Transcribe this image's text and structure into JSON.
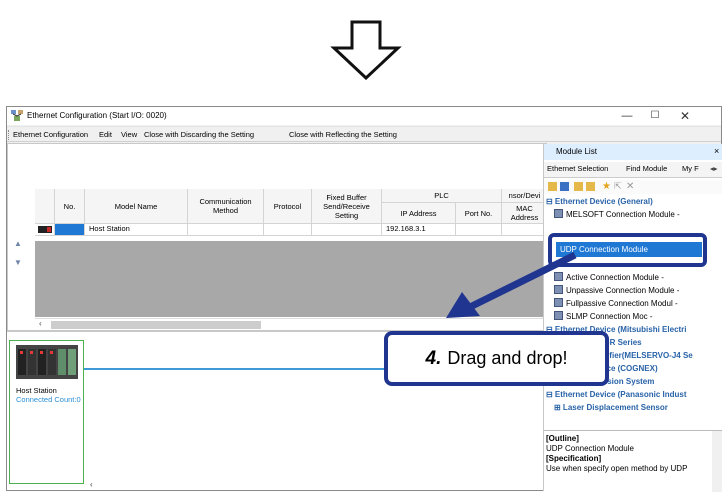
{
  "window": {
    "title": "Ethernet Configuration (Start I/O: 0020)",
    "minimize": "—",
    "maximize": "☐",
    "close": "✕"
  },
  "menu": [
    "Ethernet Configuration",
    "Edit",
    "View",
    "Close with Discarding the Setting",
    "Close with Reflecting the Setting"
  ],
  "table": {
    "headers": {
      "no": "No.",
      "model": "Model Name",
      "comm": "Communication Method",
      "protocol": "Protocol",
      "fixed": "Fixed Buffer Send/Receive Setting",
      "plc": "PLC",
      "ip": "IP Address",
      "port": "Port No.",
      "sensor": "nsor/Devi",
      "mac": "MAC Address"
    },
    "rows": [
      {
        "no": "",
        "model": "Host Station",
        "comm": "",
        "protocol": "",
        "fixed": "",
        "ip": "192.168.3.1",
        "port": "",
        "mac": ""
      }
    ]
  },
  "host": {
    "label": "Host Station",
    "connection": "Connected Count:0"
  },
  "module_panel": {
    "title": "Module List",
    "close": "×",
    "tabs": [
      "Ethernet Selection",
      "Find Module",
      "My F"
    ],
    "tree": [
      {
        "text": "⊟ Ethernet Device (General)",
        "kind": "header"
      },
      {
        "text": "MELSOFT Connection Module",
        "kind": "item",
        "suffix": "-"
      },
      {
        "text": "",
        "kind": "spacer"
      },
      {
        "text": "",
        "kind": "spacer"
      },
      {
        "text": "",
        "kind": "spacer"
      },
      {
        "text": "Active Connection Module",
        "kind": "item",
        "suffix": "-"
      },
      {
        "text": "Unpassive Connection Module",
        "kind": "item",
        "suffix": "-"
      },
      {
        "text": "Fullpassive Connection Modul",
        "kind": "item",
        "suffix": "-"
      },
      {
        "text": "SLMP Connection Moc",
        "kind": "item",
        "suffix": "-"
      },
      {
        "text": "⊟ Ethernet Device (Mitsubishi Electri",
        "kind": "header"
      },
      {
        "text": "⊞ MELSEC iQ-R Series",
        "kind": "header"
      },
      {
        "text": "⊞ Servo Amplifier(MELSERVO-J4 Se",
        "kind": "header"
      },
      {
        "text": "⊟ Ethernet Device (COGNEX)",
        "kind": "header"
      },
      {
        "text": "⊞ COGNEX Vision System",
        "kind": "header"
      },
      {
        "text": "⊟ Ethernet Device (Panasonic Indust",
        "kind": "header"
      },
      {
        "text": "⊞ Laser Displacement Sensor",
        "kind": "header"
      }
    ],
    "selected": "UDP Connection Module",
    "outline": [
      "[Outline]",
      "UDP Connection Module",
      "[Specification]",
      "Use when specify open method by UDP"
    ]
  },
  "callout": {
    "step": "4.",
    "text": "Drag and drop!"
  },
  "colors": {
    "accent": "#20358f",
    "selection": "#1e78d4",
    "link": "#2b8fd6",
    "tree_header": "#2862a8"
  }
}
